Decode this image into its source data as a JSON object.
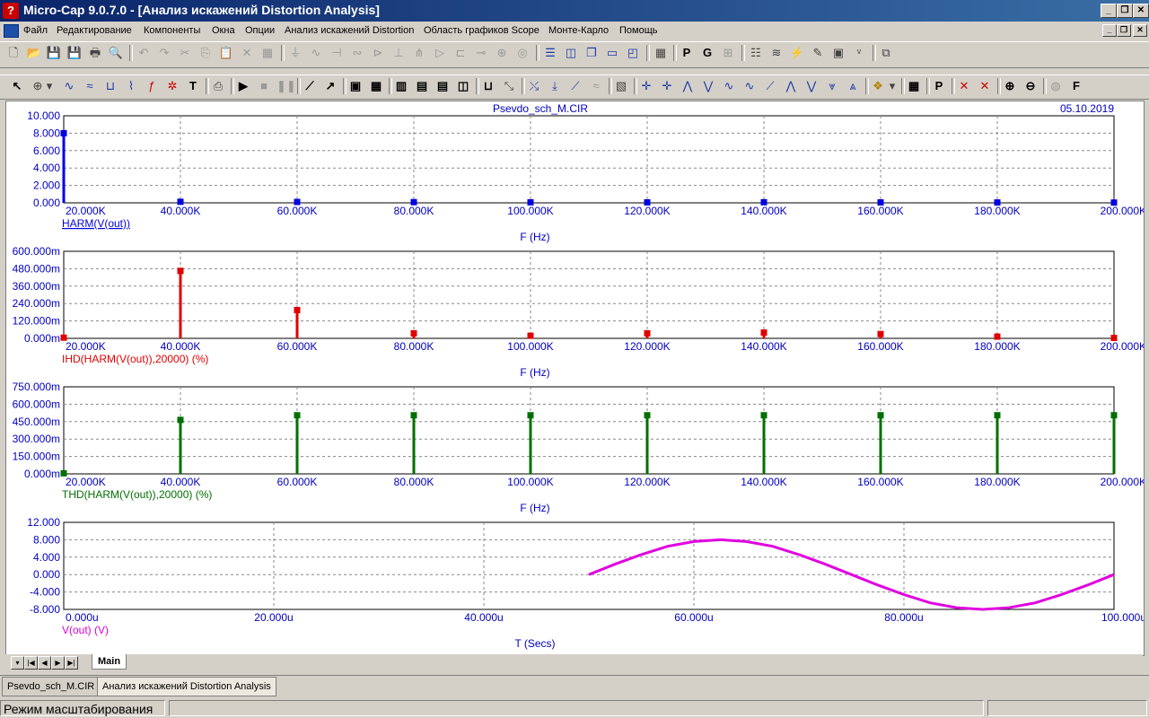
{
  "window": {
    "title": "Micro-Cap 9.0.7.0 - [Анализ искажений Distortion Analysis]"
  },
  "menu": [
    "Файл",
    "Редактирование",
    "Компоненты",
    "Окна",
    "Опции",
    "Анализ искажений Distortion",
    "Область графиков Scope",
    "Монте-Карло",
    "Помощь"
  ],
  "plot_header": {
    "title": "Psevdo_sch_M.CIR",
    "date": "05.10.2019"
  },
  "charts": [
    {
      "type": "bar",
      "series_label": "HARM(V(out))",
      "xlabel": "F (Hz)",
      "color": "#0000e0",
      "yticks": [
        "10.000",
        "8.000",
        "6.000",
        "4.000",
        "2.000",
        "0.000"
      ],
      "xticks": [
        "20.000K",
        "40.000K",
        "60.000K",
        "80.000K",
        "100.000K",
        "120.000K",
        "140.000K",
        "160.000K",
        "180.000K",
        "200.000K"
      ],
      "ylim": [
        0,
        10
      ],
      "xlim": [
        20000,
        200000
      ],
      "x": [
        20000,
        40000,
        60000,
        80000,
        100000,
        120000,
        140000,
        160000,
        180000,
        200000
      ],
      "values": [
        8.0,
        0.12,
        0.1,
        0.08,
        0.06,
        0.05,
        0.07,
        0.05,
        0.04,
        0.03
      ]
    },
    {
      "type": "bar",
      "series_label": "IHD(HARM(V(out)),20000) (%)",
      "xlabel": "F (Hz)",
      "color": "#e00000",
      "yticks": [
        "600.000m",
        "480.000m",
        "360.000m",
        "240.000m",
        "120.000m",
        "0.000m"
      ],
      "xticks": [
        "20.000K",
        "40.000K",
        "60.000K",
        "80.000K",
        "100.000K",
        "120.000K",
        "140.000K",
        "160.000K",
        "180.000K",
        "200.000K"
      ],
      "ylim": [
        0,
        600
      ],
      "xlim": [
        20000,
        200000
      ],
      "x": [
        20000,
        40000,
        60000,
        80000,
        100000,
        120000,
        140000,
        160000,
        180000,
        200000
      ],
      "values": [
        5,
        465,
        195,
        35,
        18,
        35,
        40,
        30,
        12,
        3
      ]
    },
    {
      "type": "bar",
      "series_label": "THD(HARM(V(out)),20000) (%)",
      "xlabel": "F (Hz)",
      "color": "#007000",
      "yticks": [
        "750.000m",
        "600.000m",
        "450.000m",
        "300.000m",
        "150.000m",
        "0.000m"
      ],
      "xticks": [
        "20.000K",
        "40.000K",
        "60.000K",
        "80.000K",
        "100.000K",
        "120.000K",
        "140.000K",
        "160.000K",
        "180.000K",
        "200.000K"
      ],
      "ylim": [
        0,
        750
      ],
      "xlim": [
        20000,
        200000
      ],
      "x": [
        20000,
        40000,
        60000,
        80000,
        100000,
        120000,
        140000,
        160000,
        180000,
        200000
      ],
      "values": [
        5,
        465,
        505,
        505,
        505,
        505,
        505,
        505,
        505,
        505
      ]
    },
    {
      "type": "line",
      "series_label": "V(out) (V)",
      "xlabel": "T (Secs)",
      "color": "#e000e0",
      "yticks": [
        "12.000",
        "8.000",
        "4.000",
        "0.000",
        "-4.000",
        "-8.000"
      ],
      "xticks": [
        "0.000u",
        "20.000u",
        "40.000u",
        "60.000u",
        "80.000u",
        "100.000u"
      ],
      "ylim": [
        -8,
        12
      ],
      "xlim": [
        0,
        100
      ],
      "x": [
        50,
        52.5,
        55,
        57.5,
        60,
        62.5,
        65,
        67.5,
        70,
        72.5,
        75,
        77.5,
        80,
        82.5,
        85,
        87.5,
        90,
        92.5,
        95,
        97.5,
        100
      ],
      "values": [
        0,
        2.4,
        4.6,
        6.5,
        7.6,
        8.0,
        7.6,
        6.5,
        4.6,
        2.4,
        0,
        -2.4,
        -4.6,
        -6.5,
        -7.6,
        -8.0,
        -7.6,
        -6.5,
        -4.6,
        -2.4,
        0
      ]
    }
  ],
  "main_tab": "Main",
  "doc_tabs": [
    "Psevdo_sch_M.CIR",
    "Анализ искажений Distortion Analysis"
  ],
  "status": {
    "mode": "Режим масштабирования"
  }
}
